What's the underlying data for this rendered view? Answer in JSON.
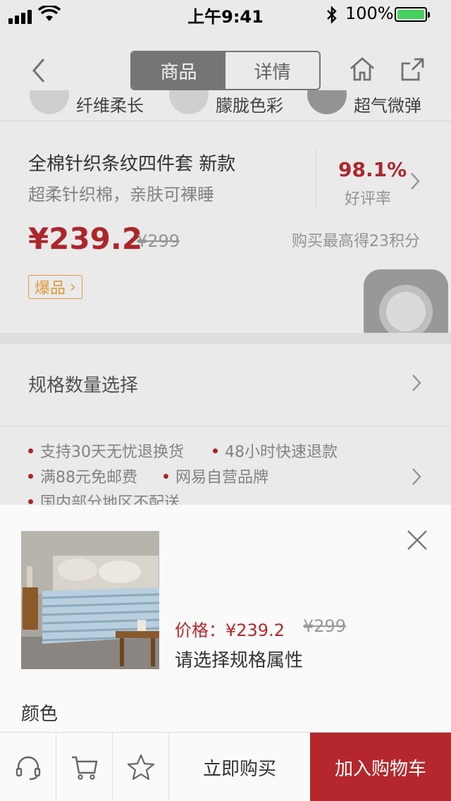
{
  "status_bar": {
    "time": "上午9:41",
    "battery": "100%"
  },
  "nav": {
    "tabs": [
      {
        "label": "商品",
        "active": true
      },
      {
        "label": "详情",
        "active": false
      }
    ],
    "icons": {
      "back": "chevron-left-icon",
      "home": "home-icon",
      "share": "share-icon"
    }
  },
  "peek": {
    "items": [
      "纤维柔长",
      "朦胧色彩",
      "超气微弹"
    ]
  },
  "product": {
    "title": "全棉针织条纹四件套 新款",
    "subtitle": "超柔针织棉，亲肤可裸睡",
    "rating_value": "98.1%",
    "rating_label": "好评率",
    "price": "¥239.2",
    "original_price": "¥299",
    "points": "购买最高得23积分",
    "badge": "爆品",
    "badge_arrow": "›"
  },
  "spec": {
    "label": "规格数量选择"
  },
  "services": [
    "支持30天无忧退换货",
    "48小时快速退款",
    "满88元免邮费",
    "网易自营品牌",
    "国内部分地区不配送"
  ],
  "sheet": {
    "price_label": "价格：¥239.2",
    "original_price": "¥299",
    "prompt": "请选择规格属性",
    "color_label": "颜色"
  },
  "action_bar": {
    "icons": [
      "headset-icon",
      "cart-icon",
      "star-icon"
    ],
    "buy_now": "立即购买",
    "add_to_cart": "加入购物车"
  },
  "colors": {
    "accent": "#b4282d",
    "badge": "#e6a23c",
    "battery": "#4cd964"
  }
}
